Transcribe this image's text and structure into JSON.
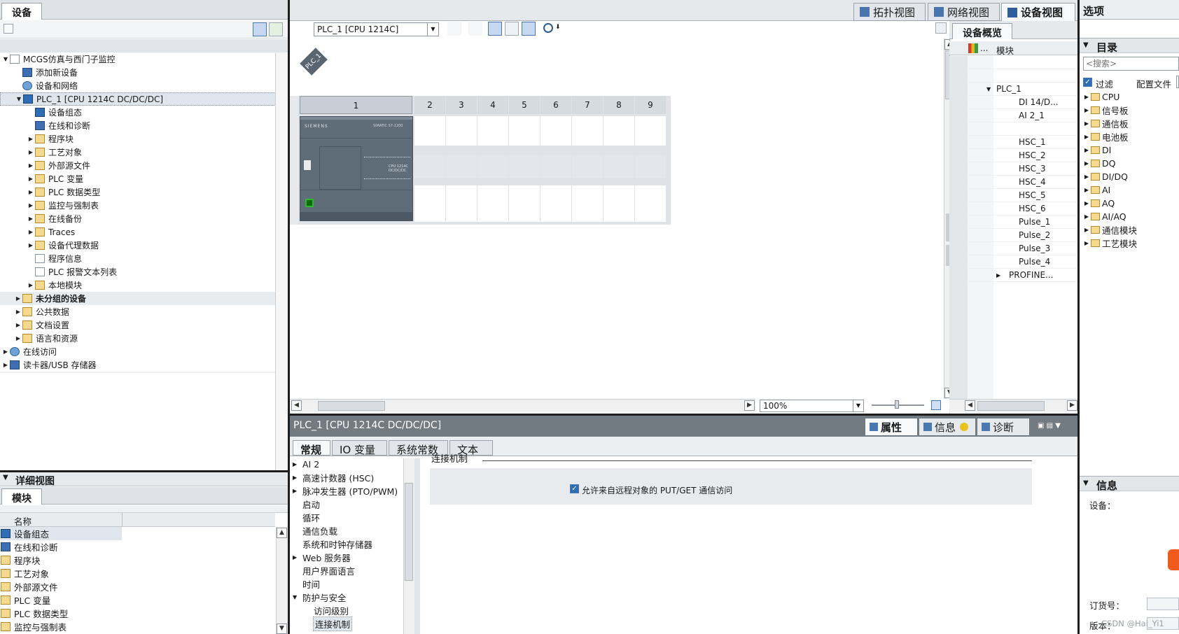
{
  "left_panel": {
    "tab": "设备",
    "tree": [
      {
        "label": "MCGS仿真与西门子监控",
        "indent": 0,
        "tri": "▼",
        "icon": "project-icon",
        "bold": false
      },
      {
        "label": "添加新设备",
        "indent": 1,
        "tri": "",
        "icon": "add-device-icon",
        "bold": false
      },
      {
        "label": "设备和网络",
        "indent": 1,
        "tri": "",
        "icon": "network-icon",
        "bold": false
      },
      {
        "label": "PLC_1 [CPU 1214C DC/DC/DC]",
        "indent": 1,
        "tri": "▼",
        "icon": "plc-icon",
        "bold": false,
        "selected": true
      },
      {
        "label": "设备组态",
        "indent": 2,
        "tri": "",
        "icon": "device-config-icon",
        "bold": false
      },
      {
        "label": "在线和诊断",
        "indent": 2,
        "tri": "",
        "icon": "diagnostics-icon",
        "bold": false
      },
      {
        "label": "程序块",
        "indent": 2,
        "tri": "▶",
        "icon": "folder-icon",
        "bold": false
      },
      {
        "label": "工艺对象",
        "indent": 2,
        "tri": "▶",
        "icon": "folder-icon",
        "bold": false
      },
      {
        "label": "外部源文件",
        "indent": 2,
        "tri": "▶",
        "icon": "folder-icon",
        "bold": false
      },
      {
        "label": "PLC 变量",
        "indent": 2,
        "tri": "▶",
        "icon": "folder-icon",
        "bold": false
      },
      {
        "label": "PLC 数据类型",
        "indent": 2,
        "tri": "▶",
        "icon": "folder-icon",
        "bold": false
      },
      {
        "label": "监控与强制表",
        "indent": 2,
        "tri": "▶",
        "icon": "folder-icon",
        "bold": false
      },
      {
        "label": "在线备份",
        "indent": 2,
        "tri": "▶",
        "icon": "folder-icon",
        "bold": false
      },
      {
        "label": "Traces",
        "indent": 2,
        "tri": "▶",
        "icon": "folder-icon",
        "bold": false
      },
      {
        "label": "设备代理数据",
        "indent": 2,
        "tri": "▶",
        "icon": "folder-icon",
        "bold": false
      },
      {
        "label": "程序信息",
        "indent": 2,
        "tri": "",
        "icon": "program-info-icon",
        "bold": false
      },
      {
        "label": "PLC 报警文本列表",
        "indent": 2,
        "tri": "",
        "icon": "alarm-text-icon",
        "bold": false
      },
      {
        "label": "本地模块",
        "indent": 2,
        "tri": "▶",
        "icon": "folder-icon",
        "bold": false
      },
      {
        "label": "未分组的设备",
        "indent": 1,
        "tri": "▶",
        "icon": "folder-icon",
        "bold": true
      },
      {
        "label": "公共数据",
        "indent": 1,
        "tri": "▶",
        "icon": "folder-icon",
        "bold": false
      },
      {
        "label": "文档设置",
        "indent": 1,
        "tri": "▶",
        "icon": "folder-icon",
        "bold": false
      },
      {
        "label": "语言和资源",
        "indent": 1,
        "tri": "▶",
        "icon": "folder-icon",
        "bold": false
      },
      {
        "label": "在线访问",
        "indent": 0,
        "tri": "▶",
        "icon": "online-access-icon",
        "bold": false
      },
      {
        "label": "读卡器/USB 存储器",
        "indent": 0,
        "tri": "▶",
        "icon": "card-reader-icon",
        "bold": false
      }
    ],
    "detail_view": {
      "title": "详细视图",
      "tab": "模块",
      "column_header": "名称",
      "rows": [
        "设备组态",
        "在线和诊断",
        "程序块",
        "工艺对象",
        "外部源文件",
        "PLC 变量",
        "PLC 数据类型",
        "监控与强制表"
      ]
    }
  },
  "center": {
    "view_tabs": [
      "拓扑视图",
      "网络视图",
      "设备视图"
    ],
    "device_select": "PLC_1 [CPU 1214C]",
    "device_label": "PLC_1",
    "slots": [
      "1",
      "2",
      "3",
      "4",
      "5",
      "6",
      "7",
      "8",
      "9"
    ],
    "cpu_brand": "SIEMENS",
    "cpu_model": "SIMATIC S7-1200",
    "cpu_type": "CPU 1214C DC/DC/DC",
    "zoom": "100%"
  },
  "overview": {
    "title": "设备概览",
    "col_module": "模块",
    "col_dots": "...",
    "rows": [
      {
        "label": "",
        "indent": 0
      },
      {
        "label": "",
        "indent": 0
      },
      {
        "label": "PLC_1",
        "indent": 1,
        "tri": "▼"
      },
      {
        "label": "DI 14/D...",
        "indent": 2
      },
      {
        "label": "AI 2_1",
        "indent": 2
      },
      {
        "label": "",
        "indent": 0
      },
      {
        "label": "HSC_1",
        "indent": 2
      },
      {
        "label": "HSC_2",
        "indent": 2
      },
      {
        "label": "HSC_3",
        "indent": 2
      },
      {
        "label": "HSC_4",
        "indent": 2
      },
      {
        "label": "HSC_5",
        "indent": 2
      },
      {
        "label": "HSC_6",
        "indent": 2
      },
      {
        "label": "Pulse_1",
        "indent": 2
      },
      {
        "label": "Pulse_2",
        "indent": 2
      },
      {
        "label": "Pulse_3",
        "indent": 2
      },
      {
        "label": "Pulse_4",
        "indent": 2
      },
      {
        "label": "PROFINE...",
        "indent": 2,
        "tri": "▶"
      }
    ]
  },
  "properties": {
    "title": "PLC_1 [CPU 1214C DC/DC/DC]",
    "right_tabs": [
      "属性",
      "信息",
      "诊断"
    ],
    "tabs": [
      "常规",
      "IO 变量",
      "系统常数",
      "文本"
    ],
    "nav": [
      {
        "label": "AI 2",
        "tri": "▶",
        "indent": 0
      },
      {
        "label": "高速计数器 (HSC)",
        "tri": "▶",
        "indent": 0
      },
      {
        "label": "脉冲发生器 (PTO/PWM)",
        "tri": "▶",
        "indent": 0
      },
      {
        "label": "启动",
        "tri": "",
        "indent": 0
      },
      {
        "label": "循环",
        "tri": "",
        "indent": 0
      },
      {
        "label": "通信负载",
        "tri": "",
        "indent": 0
      },
      {
        "label": "系统和时钟存储器",
        "tri": "",
        "indent": 0
      },
      {
        "label": "Web 服务器",
        "tri": "▶",
        "indent": 0
      },
      {
        "label": "用户界面语言",
        "tri": "",
        "indent": 0
      },
      {
        "label": "时间",
        "tri": "",
        "indent": 0
      },
      {
        "label": "防护与安全",
        "tri": "▼",
        "indent": 0
      },
      {
        "label": "访问级别",
        "tri": "",
        "indent": 1
      },
      {
        "label": "连接机制",
        "tri": "",
        "indent": 1,
        "selected": true
      }
    ],
    "section_title": "连接机制",
    "checkbox_label": "允许来自远程对象的 PUT/GET 通信访问",
    "checkbox_checked": true
  },
  "right_panel": {
    "title": "选项",
    "catalog_title": "目录",
    "search_placeholder": "<搜索>",
    "filter_label": "过滤",
    "profile_label": "配置文件",
    "catalog": [
      "CPU",
      "信号板",
      "通信板",
      "电池板",
      "DI",
      "DQ",
      "DI/DQ",
      "AI",
      "AQ",
      "AI/AQ",
      "通信模块",
      "工艺模块"
    ],
    "info_title": "信息",
    "device_label": "设备：",
    "order_label": "订货号：",
    "version_label": "版本：",
    "watermark": "CSDN @Hai_Yi1"
  }
}
